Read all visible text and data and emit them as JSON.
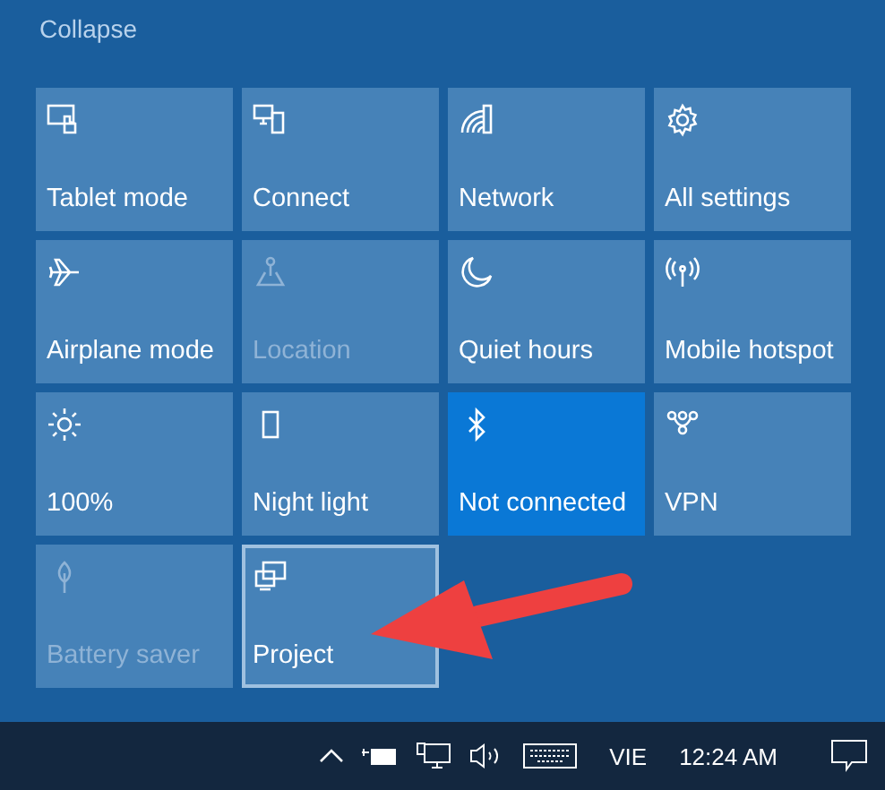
{
  "header": {
    "collapse": "Collapse"
  },
  "tiles": [
    {
      "label": "Tablet mode",
      "kind": "tablet",
      "on": false,
      "disabled": false,
      "selected": false
    },
    {
      "label": "Connect",
      "kind": "connect",
      "on": false,
      "disabled": false,
      "selected": false
    },
    {
      "label": "Network",
      "kind": "network",
      "on": false,
      "disabled": false,
      "selected": false
    },
    {
      "label": "All settings",
      "kind": "settings",
      "on": false,
      "disabled": false,
      "selected": false
    },
    {
      "label": "Airplane mode",
      "kind": "airplane",
      "on": false,
      "disabled": false,
      "selected": false
    },
    {
      "label": "Location",
      "kind": "location",
      "on": false,
      "disabled": true,
      "selected": false
    },
    {
      "label": "Quiet hours",
      "kind": "moon",
      "on": false,
      "disabled": false,
      "selected": false
    },
    {
      "label": "Mobile hotspot",
      "kind": "hotspot",
      "on": false,
      "disabled": false,
      "selected": false
    },
    {
      "label": "100%",
      "kind": "brightness",
      "on": false,
      "disabled": false,
      "selected": false
    },
    {
      "label": "Night light",
      "kind": "nightlight",
      "on": false,
      "disabled": false,
      "selected": false
    },
    {
      "label": "Not connected",
      "kind": "bluetooth",
      "on": true,
      "disabled": false,
      "selected": false
    },
    {
      "label": "VPN",
      "kind": "vpn",
      "on": false,
      "disabled": false,
      "selected": false
    },
    {
      "label": "Battery saver",
      "kind": "leaf",
      "on": false,
      "disabled": true,
      "selected": false
    },
    {
      "label": "Project",
      "kind": "project",
      "on": false,
      "disabled": false,
      "selected": true
    }
  ],
  "taskbar": {
    "language": "VIE",
    "time": "12:24 AM"
  }
}
